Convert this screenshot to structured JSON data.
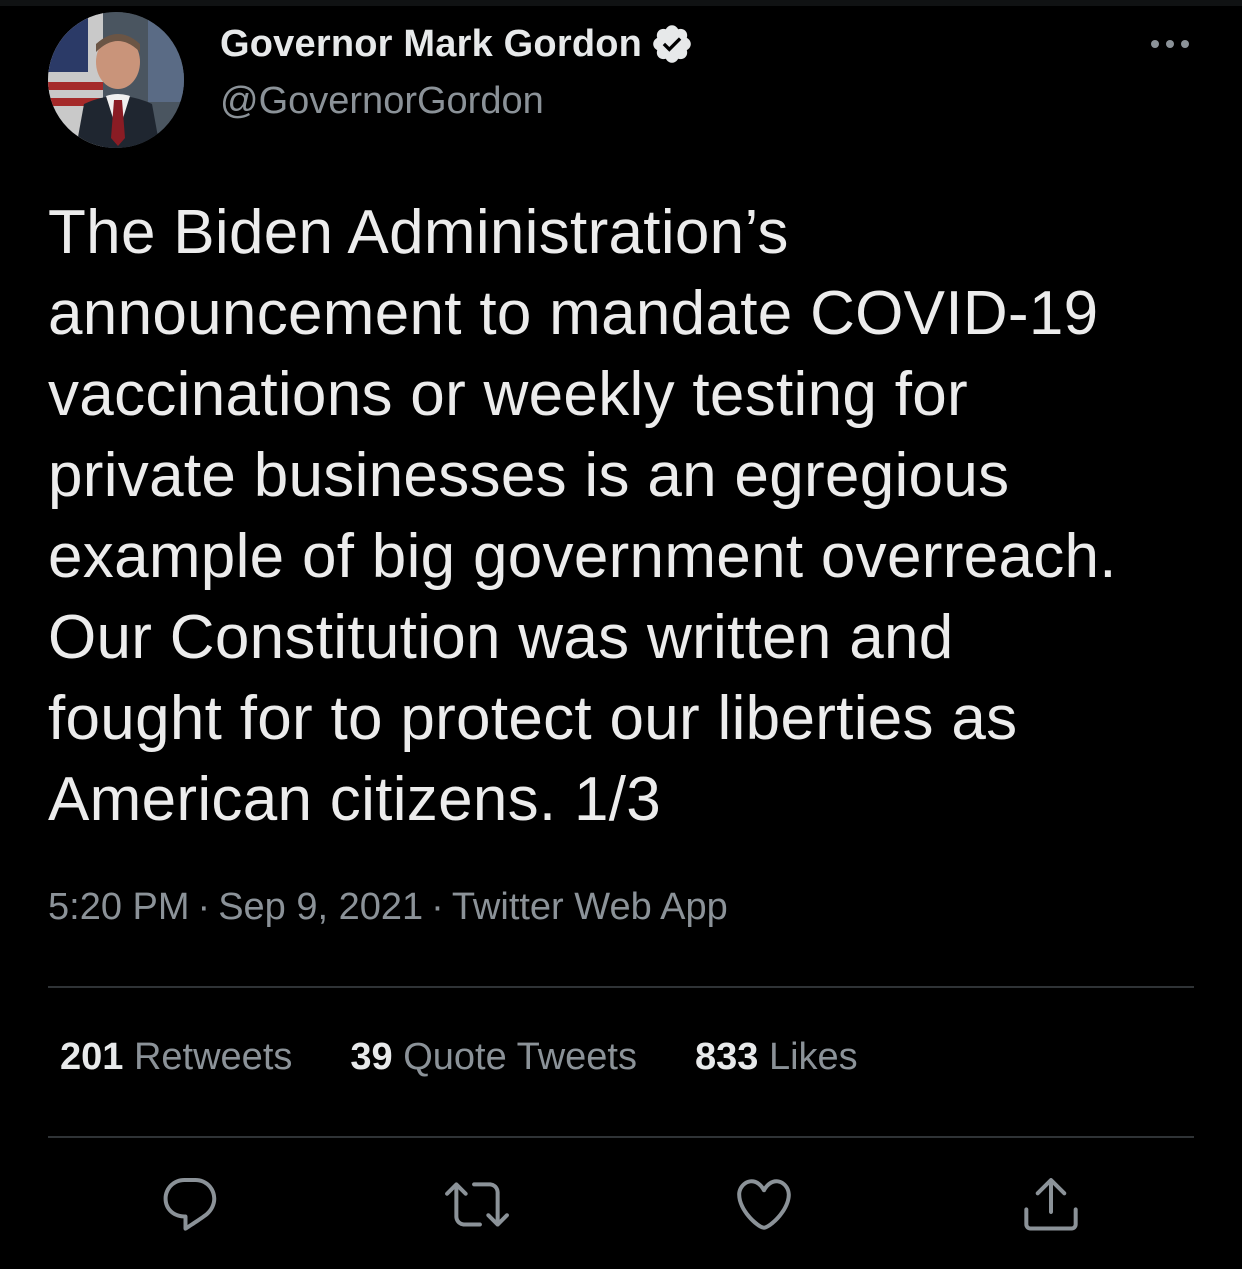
{
  "author": {
    "display_name": "Governor Mark Gordon",
    "handle": "@GovernorGordon",
    "verified": true
  },
  "tweet": {
    "text": "The Biden Administration’s\nannouncement to mandate COVID-19\nvaccinations or weekly testing for\nprivate businesses is an egregious\nexample of big government overreach.\nOur Constitution was written and\nfought for to protect our liberties as\nAmerican citizens. 1/3",
    "time": "5:20 PM",
    "date": "Sep 9, 2021",
    "source": "Twitter Web App",
    "separator": "·"
  },
  "stats": {
    "retweets": {
      "count": "201",
      "label": "Retweets"
    },
    "quotes": {
      "count": "39",
      "label": "Quote Tweets"
    },
    "likes": {
      "count": "833",
      "label": "Likes"
    }
  },
  "icons": {
    "verified": "verified-badge-icon",
    "more": "more-dots-icon",
    "reply": "reply-icon",
    "retweet": "retweet-icon",
    "like": "heart-icon",
    "share": "share-icon"
  },
  "colors": {
    "background": "#000000",
    "text": "#e7e9ea",
    "secondary": "#8b9298",
    "divider": "#2f3336"
  }
}
